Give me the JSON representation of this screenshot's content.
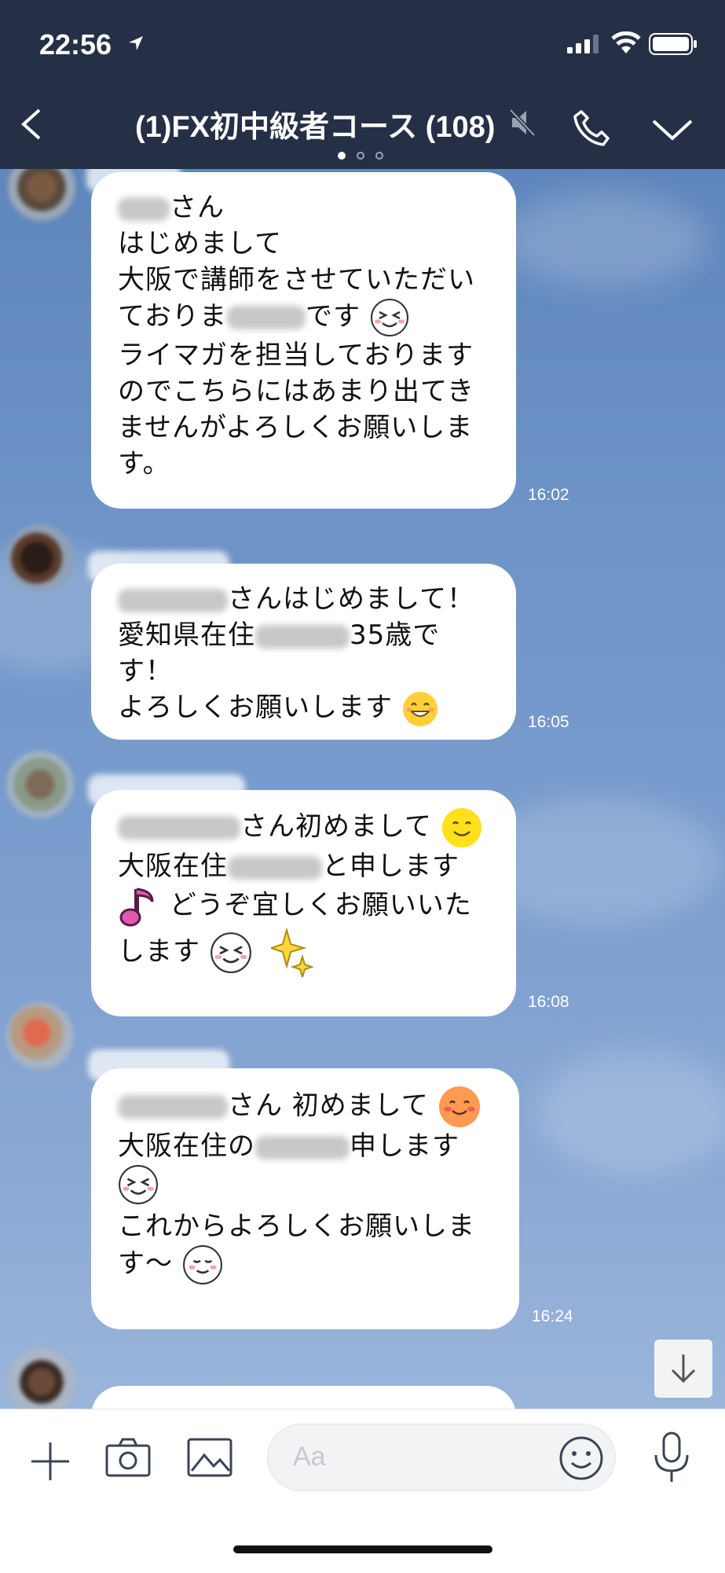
{
  "status_bar": {
    "time": "22:56"
  },
  "header": {
    "title": "(1)FX初中級者コース (108)"
  },
  "messages": [
    {
      "line1": "さん",
      "line2": "はじめまして",
      "line3": "大阪で講師をさせていただい",
      "line4a": "ておりま",
      "line4b": "です",
      "line5": "ライマガを担当しております",
      "line6": "のでこちらにはあまり出てき",
      "line7": "ませんがよろしくお願いしま",
      "line8": "す。",
      "time": "16:02"
    },
    {
      "line1": "さんはじめまして！",
      "line2a": "愛知県在住",
      "line2b": "35歳で",
      "line3": "す！",
      "line4": "よろしくお願いします",
      "time": "16:05"
    },
    {
      "line1": "さん初めまして",
      "line2a": "大阪在住",
      "line2b": "と申します",
      "line3": "どうぞ宜しくお願いいた",
      "line4": "します",
      "time": "16:08"
    },
    {
      "line1": "さん 初めまして",
      "line2a": "大阪在住の",
      "line2b": "申します",
      "line3": "これからよろしくお願いしま",
      "line4": "す〜",
      "time": "16:24"
    }
  ],
  "input": {
    "placeholder": "Aa"
  },
  "icons": [
    "location-arrow-icon",
    "signal-icon",
    "wifi-icon",
    "battery-icon",
    "back-icon",
    "mute-icon",
    "phone-icon",
    "chevron-down-icon",
    "plus-icon",
    "camera-icon",
    "image-icon",
    "emoji-icon",
    "mic-icon",
    "arrow-down-icon"
  ]
}
